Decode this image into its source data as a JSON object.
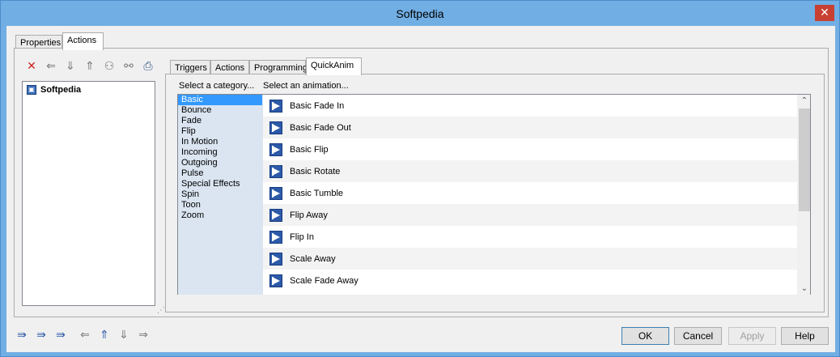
{
  "window": {
    "title": "Softpedia",
    "close_glyph": "✕"
  },
  "outer_tabs": [
    {
      "label": "Properties"
    },
    {
      "label": "Actions"
    }
  ],
  "left_toolbar": [
    {
      "icon": "delete-icon",
      "glyph": "✕",
      "color": "#cc2222"
    },
    {
      "icon": "arrow-left-icon",
      "glyph": "⇐",
      "color": "#777777"
    },
    {
      "icon": "arrow-down-icon",
      "glyph": "⇓",
      "color": "#777777"
    },
    {
      "icon": "arrow-up-icon",
      "glyph": "⇑",
      "color": "#777777"
    },
    {
      "icon": "group-icon",
      "glyph": "⚇",
      "color": "#777777"
    },
    {
      "icon": "link-icon",
      "glyph": "⚯",
      "color": "#777777"
    },
    {
      "icon": "print-icon",
      "glyph": "⎙",
      "color": "#3a5a8a"
    }
  ],
  "tree": {
    "root_label": "Softpedia"
  },
  "inner_tabs": [
    {
      "label": "Triggers"
    },
    {
      "label": "Actions"
    },
    {
      "label": "Programming"
    },
    {
      "label": "QuickAnim"
    }
  ],
  "headers": {
    "category": "Select a category...",
    "animation": "Select an animation..."
  },
  "categories": [
    "Basic",
    "Bounce",
    "Fade",
    "Flip",
    "In Motion",
    "Incoming",
    "Outgoing",
    "Pulse",
    "Special Effects",
    "Spin",
    "Toon",
    "Zoom"
  ],
  "selected_category": "Basic",
  "animations": [
    "Basic Fade In",
    "Basic Fade Out",
    "Basic Flip",
    "Basic Rotate",
    "Basic Tumble",
    "Flip Away",
    "Flip In",
    "Scale Away",
    "Scale Fade Away"
  ],
  "scroll": {
    "up_glyph": "⌃",
    "down_glyph": "⌄"
  },
  "bottom_toolbar": [
    {
      "icon": "page-import-icon",
      "glyph": "⇛",
      "color": "#2d5aa8"
    },
    {
      "icon": "page-export-icon",
      "glyph": "⇛",
      "color": "#2d5aa8"
    },
    {
      "icon": "page-edit-icon",
      "glyph": "⇛",
      "color": "#2d5aa8"
    },
    {
      "icon": "arrow-left-icon",
      "glyph": "⇐",
      "color": "#777777"
    },
    {
      "icon": "arrow-up-icon",
      "glyph": "⇑",
      "color": "#2d5aa8"
    },
    {
      "icon": "arrow-down-icon",
      "glyph": "⇓",
      "color": "#777777"
    },
    {
      "icon": "arrow-right-icon",
      "glyph": "⇒",
      "color": "#777777"
    }
  ],
  "buttons": {
    "ok": "OK",
    "cancel": "Cancel",
    "apply": "Apply",
    "help": "Help"
  }
}
